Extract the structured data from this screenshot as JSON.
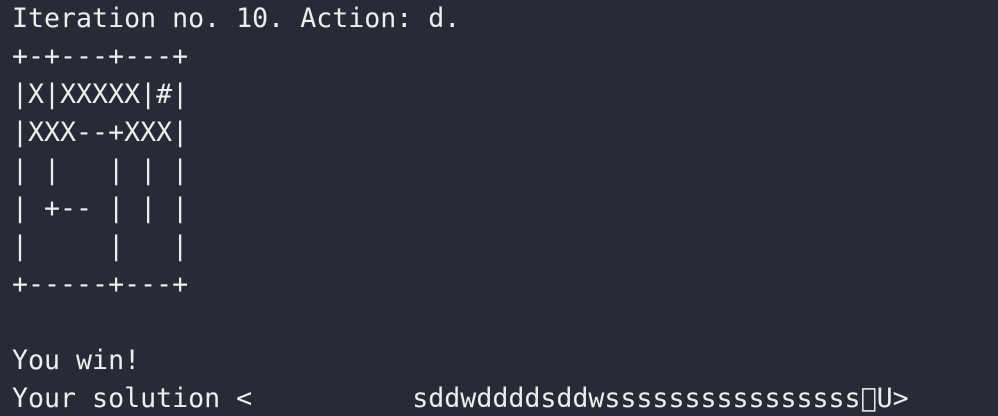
{
  "terminal": {
    "lines": [
      "Iteration no. 10. Action: d.",
      "+-+---+---+",
      "|X|XXXXX|#|",
      "|XXX--+XXX|",
      "| |   | | |",
      "| +-- | | |",
      "|     |   |",
      "+-----+---+",
      "",
      "You win!",
      "Your solution <          sddwddddsddwssssssssssssssss\u0000U>"
    ]
  },
  "colors": {
    "background": "#282a36",
    "foreground": "#eeeeee"
  }
}
